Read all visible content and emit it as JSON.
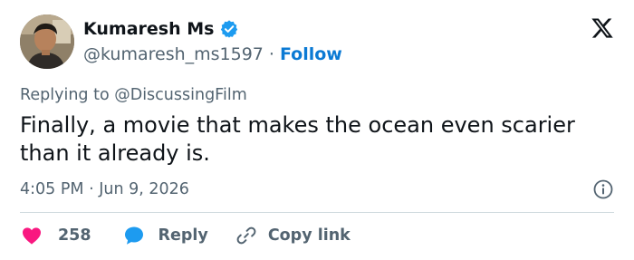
{
  "author": {
    "name": "Kumaresh Ms",
    "handle": "@kumaresh_ms1597",
    "separator": "·",
    "follow_label": "Follow"
  },
  "tweet": {
    "replying_to": "Replying to @DiscussingFilm",
    "text": "Finally, a movie that makes the ocean even scarier than it already is.",
    "timestamp": "4:05 PM · Jun 9, 2026"
  },
  "actions": {
    "like_count": "258",
    "reply_label": "Reply",
    "copy_label": "Copy link"
  },
  "icons": {
    "verified": "verified-badge-icon",
    "logo": "x-logo-icon",
    "info": "info-icon",
    "like": "heart-icon",
    "reply": "speech-bubble-icon",
    "copy": "link-icon"
  },
  "colors": {
    "text": "#0f1419",
    "secondary": "#536471",
    "accent": "#1d9bf0",
    "link": "#0b7ad4",
    "like": "#f91880",
    "divider": "#cfd9de"
  }
}
